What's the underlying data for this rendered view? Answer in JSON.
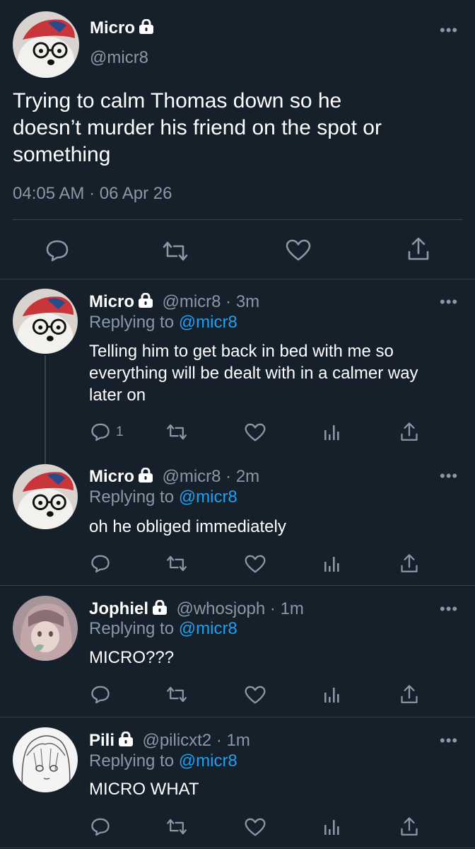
{
  "main_tweet": {
    "name": "Micro",
    "handle": "@micr8",
    "text_lines": [
      "Trying to calm Thomas down so he",
      "doesn’t murder his friend on the spot or",
      "something"
    ],
    "timestamp": "04:05 AM · 06 Apr 26"
  },
  "replies": [
    {
      "name": "Micro",
      "handle_time": "@micr8 · 3m",
      "replying_prefix": "Replying to",
      "replying_handle": "@micr8",
      "text_lines": [
        "Telling him to get back in bed with me so",
        "everything will be dealt with in a calmer way",
        "later on"
      ],
      "reply_count": "1"
    },
    {
      "name": "Micro",
      "handle_time": "@micr8 · 2m",
      "replying_prefix": "Replying to",
      "replying_handle": "@micr8",
      "text_lines": [
        "oh he obliged immediately"
      ]
    },
    {
      "name": "Jophiel",
      "handle_time": "@whosjoph · 1m",
      "replying_prefix": "Replying to",
      "replying_handle": "@micr8",
      "text_lines": [
        "MICRO???"
      ]
    },
    {
      "name": "Pili",
      "handle_time": "@pilicxt2 · 1m",
      "replying_prefix": "Replying to",
      "replying_handle": "@micr8",
      "text_lines": [
        "MICRO WHAT"
      ]
    }
  ],
  "icons": {
    "reply": "reply-icon",
    "retweet": "retweet-icon",
    "like": "heart-icon",
    "analytics": "analytics-icon",
    "share": "share-icon",
    "more": "more-icon",
    "lock": "lock-icon"
  },
  "colors": {
    "background": "#15202b",
    "muted": "#8899a6",
    "link": "#1da1f2",
    "divider": "#38444d"
  }
}
